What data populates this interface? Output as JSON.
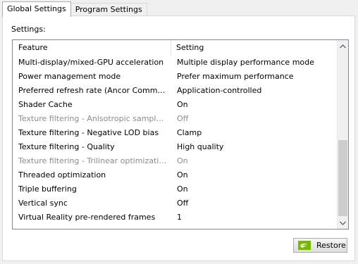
{
  "tabs": [
    {
      "label": "Global Settings",
      "active": true
    },
    {
      "label": "Program Settings",
      "active": false
    }
  ],
  "settings_label": "Settings:",
  "table": {
    "columns": [
      "Feature",
      "Setting"
    ],
    "rows": [
      {
        "feature": "Multi-display/mixed-GPU acceleration",
        "setting": "Multiple display performance mode",
        "disabled": false
      },
      {
        "feature": "Power management mode",
        "setting": "Prefer maximum performance",
        "disabled": false
      },
      {
        "feature": "Preferred refresh rate (Ancor Communicat...",
        "setting": "Application-controlled",
        "disabled": false
      },
      {
        "feature": "Shader Cache",
        "setting": "On",
        "disabled": false
      },
      {
        "feature": "Texture filtering - Anisotropic sample opti...",
        "setting": "Off",
        "disabled": true
      },
      {
        "feature": "Texture filtering - Negative LOD bias",
        "setting": "Clamp",
        "disabled": false
      },
      {
        "feature": "Texture filtering - Quality",
        "setting": "High quality",
        "disabled": false
      },
      {
        "feature": "Texture filtering - Trilinear optimization",
        "setting": "On",
        "disabled": true
      },
      {
        "feature": "Threaded optimization",
        "setting": "On",
        "disabled": false
      },
      {
        "feature": "Triple buffering",
        "setting": "On",
        "disabled": false
      },
      {
        "feature": "Vertical sync",
        "setting": "Off",
        "disabled": false
      },
      {
        "feature": "Virtual Reality pre-rendered frames",
        "setting": "1",
        "disabled": false
      }
    ]
  },
  "scrollbar": {
    "up_icon": "chevron-up-icon",
    "down_icon": "chevron-down-icon"
  },
  "restore_button": {
    "label": "Restore",
    "icon": "nvidia-logo-icon"
  },
  "colors": {
    "nvidia_green": "#76b900",
    "disabled_text": "#8c8c8c"
  }
}
